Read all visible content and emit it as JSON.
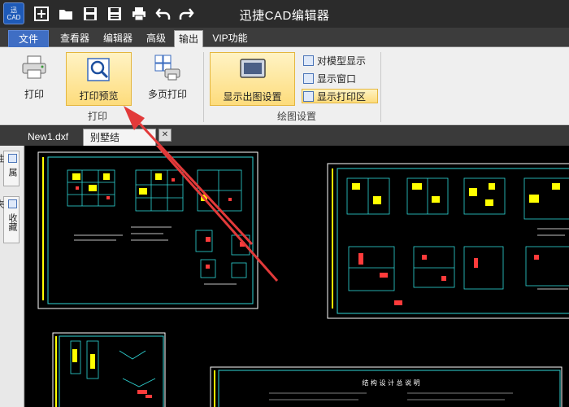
{
  "titlebar": {
    "logo_line1": "迅",
    "logo_line2": "CAD",
    "title": "迅捷CAD编辑器",
    "quick_access": [
      "new-icon",
      "open-folder-icon",
      "save-icon",
      "save-as-icon",
      "print-icon",
      "undo-icon",
      "redo-icon"
    ]
  },
  "menu": {
    "tabs": [
      "文件",
      "查看器",
      "编辑器",
      "高级",
      "输出",
      "VIP功能"
    ],
    "active": "输出"
  },
  "ribbon": {
    "print_group": {
      "label": "打印",
      "buttons": [
        "打印",
        "打印预览",
        "多页打印"
      ]
    },
    "draw_settings_group": {
      "label": "绘图设置",
      "show_layout_button": "显示出图设置",
      "options": [
        "对模型显示",
        "显示窗口",
        "显示打印区"
      ]
    }
  },
  "documents": {
    "tabs": [
      "New1.dxf",
      "别墅结构.dwg"
    ],
    "active": "别墅结构.dwg"
  },
  "side_panel": {
    "tabs": [
      "属性",
      "收藏夹"
    ]
  },
  "canvas": {
    "sheet_title": "结 构 设 计 总 说 明"
  },
  "colors": {
    "accent_blue": "#3f6ec4",
    "highlight": "#fddc7c",
    "arrow_red": "#e23a3a",
    "cad_cyan": "#2fd6d6"
  }
}
